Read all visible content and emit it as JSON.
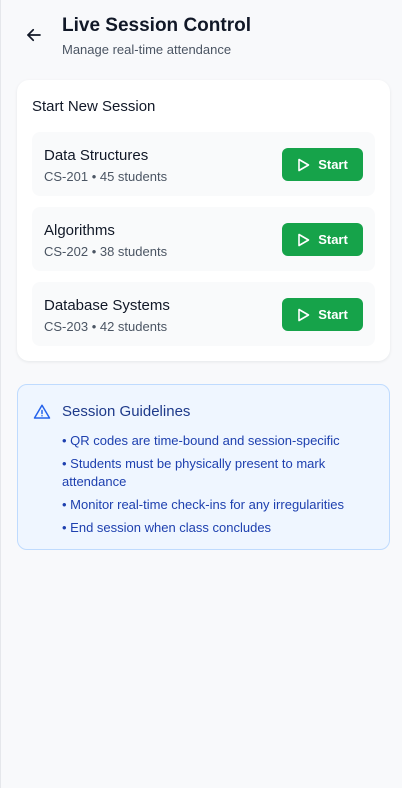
{
  "header": {
    "title": "Live Session Control",
    "subtitle": "Manage real-time attendance",
    "back_icon": "arrow-left-icon"
  },
  "new_session": {
    "title": "Start New Session",
    "sessions": [
      {
        "name": "Data Structures",
        "meta": "CS-201 • 45 students",
        "button": "Start"
      },
      {
        "name": "Algorithms",
        "meta": "CS-202 • 38 students",
        "button": "Start"
      },
      {
        "name": "Database Systems",
        "meta": "CS-203 • 42 students",
        "button": "Start"
      }
    ]
  },
  "guidelines": {
    "title": "Session Guidelines",
    "icon": "alert-triangle-icon",
    "items": [
      "• QR codes are time-bound and session-specific",
      "• Students must be physically present to mark attendance",
      "• Monitor real-time check-ins for any irregularities",
      "• End session when class concludes"
    ]
  },
  "colors": {
    "accent_green": "#16a34a",
    "info_bg": "#eff6ff",
    "info_border": "#bfdbfe",
    "info_text": "#1e40af",
    "info_title": "#1e3a8a"
  }
}
